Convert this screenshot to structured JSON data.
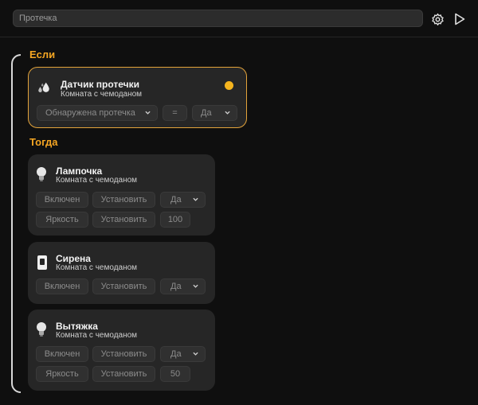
{
  "search": {
    "placeholder": "Протечка"
  },
  "sections": {
    "if_label": "Если",
    "then_label": "Тогда"
  },
  "condition": {
    "device_name": "Датчик протечки",
    "room": "Комната с чемоданом",
    "status_color": "#f5b41e",
    "parameter": "Обнаружена протечка",
    "operator": "=",
    "value": "Да"
  },
  "actions": [
    {
      "device_name": "Лампочка",
      "room": "Комната с чемоданом",
      "icon": "bulb-icon",
      "rows": [
        {
          "param": "Включен",
          "action": "Установить",
          "value": "Да"
        },
        {
          "param": "Яркость",
          "action": "Установить",
          "value": "100"
        }
      ]
    },
    {
      "device_name": "Сирена",
      "room": "Комната с чемоданом",
      "icon": "siren-icon",
      "rows": [
        {
          "param": "Включен",
          "action": "Установить",
          "value": "Да"
        }
      ]
    },
    {
      "device_name": "Вытяжка",
      "room": "Комната с чемоданом",
      "icon": "bulb-icon",
      "rows": [
        {
          "param": "Включен",
          "action": "Установить",
          "value": "Да"
        },
        {
          "param": "Яркость",
          "action": "Установить",
          "value": "50"
        }
      ]
    }
  ],
  "colors": {
    "accent": "#f5a623",
    "card": "#262626",
    "chip": "#303030"
  }
}
